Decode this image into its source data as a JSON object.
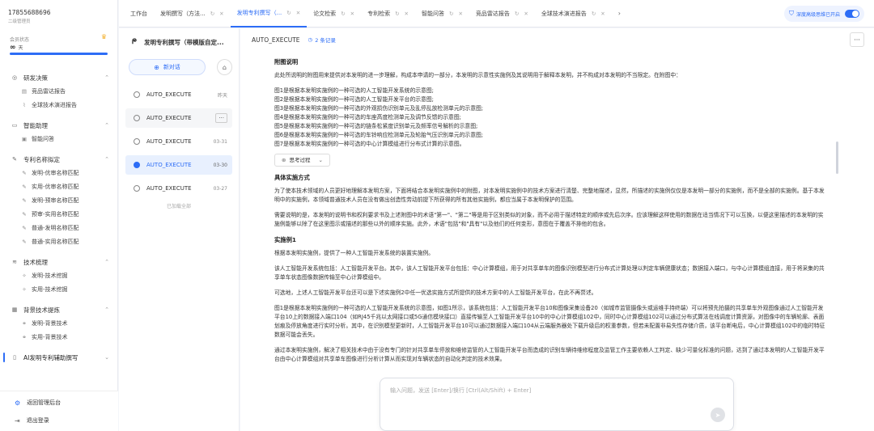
{
  "user": {
    "phone": "17855688696",
    "subtitle": "二级管理员",
    "member_label": "会员状态",
    "member_value_symbol": "∞",
    "member_value_text": "天"
  },
  "nav": {
    "groups": [
      {
        "label": "研发决策",
        "items": [
          "竞品雷达报告",
          "全球技术演进报告"
        ]
      },
      {
        "label": "智能助理",
        "items": [
          "智能问答"
        ]
      },
      {
        "label": "专利名称拟定",
        "items": [
          "发明-优审名称匹配",
          "实用-优审名称匹配",
          "发明-预审名称匹配",
          "预审-实用名称匹配",
          "普通-发明名称匹配",
          "普通-实用名称匹配"
        ]
      },
      {
        "label": "技术梳理",
        "items": [
          "发明-技术挖掘",
          "实用-技术挖掘"
        ]
      },
      {
        "label": "背景技术提炼",
        "items": [
          "发明-背景技术",
          "实用-背景技术"
        ]
      },
      {
        "label": "AI发明专利辅助撰写",
        "items": []
      }
    ],
    "admin_label": "返回管理后台",
    "logout_label": "退出登录"
  },
  "tabs": {
    "items": [
      {
        "label": "工作台"
      },
      {
        "label": "发明撰写（方法..."
      },
      {
        "label": "发明专利撰写（..."
      },
      {
        "label": "论文检索"
      },
      {
        "label": "专利检索"
      },
      {
        "label": "智能问答"
      },
      {
        "label": "竞品雷达报告"
      },
      {
        "label": "全球技术演进报告"
      }
    ],
    "active_index": 2,
    "deep_thinking_label": "深度高级思维已开启"
  },
  "conversations": {
    "title": "发明专利撰写（带模版自定...",
    "new_chat": "新对话",
    "items": [
      {
        "name": "AUTO_EXECUTE",
        "date": "昨天"
      },
      {
        "name": "AUTO_EXECUTE",
        "date": "···"
      },
      {
        "name": "AUTO_EXECUTE",
        "date": "03-31"
      },
      {
        "name": "AUTO_EXECUTE",
        "date": "03-30"
      },
      {
        "name": "AUTO_EXECUTE",
        "date": "03-27"
      }
    ],
    "loaded_all": "已加载全部"
  },
  "main": {
    "title": "AUTO_EXECUTE",
    "record_count": "2 条记录",
    "sec_fig_title": "附图说明",
    "sec_fig_intro": "此处所说明的附图用来提供对本发明的进一步理解，构成本申请的一部分，本发明的示意性实施例及其说明用于解释本发明，并不构成对本发明的不当限定。在附图中：",
    "figs": [
      "图1是根据本发明实施例的一种可选的人工智能开发系统的示意图;",
      "图2是根据本发明实施例的一种可选的人工智能开发平台的示意图;",
      "图3是根据本发明实施例的一种可选的外观损伤识别单元及乱停乱放检测单元的示意图;",
      "图4是根据本发明实施例的一种可选的车座高度检测单元及调节反馈的示意图;",
      "图5是根据本发明实施例的一种可选的链条松紧度识别单元及频率信号解析的示意图;",
      "图6是根据本发明实施例的一种可选的车铃响应检测单元及轮胎气压识别单元的示意图;",
      "图7是根据本发明实施例的一种可选的中心计算模组进行分布式计算的示意图。"
    ],
    "think_label": "思考过程",
    "sec_impl_title": "具体实施方式",
    "impl_p1": "为了使本技术领域的人员更好地理解本发明方案，下面将结合本发明实施例中的附图，对本发明实施例中的技术方案进行清楚、完整地描述，显然，所描述的实施例仅仅是本发明一部分的实施例，而不是全部的实施例。基于本发明中的实施例，本领域普通技术人员在没有做出创造性劳动前提下所获得的所有其他实施例，都应当属于本发明保护的范围。",
    "impl_p2": "需要说明的是，本发明的说明书和权利要求书及上述附图中的术语\"第一\"、\"第二\"等是用于区别类似的对象，而不必用于描述特定的顺序或先后次序。应该理解这样使用的数据在适当情况下可以互换，以便这里描述的本发明的实施例能够以除了在这里图示或描述的那些以外的顺序实施。此外，术语\"包括\"和\"具有\"以及他们的任何变形，意图在于覆盖不排他的包含。",
    "ex1_title": "实施例1",
    "ex1_p1": "根据本发明实施例，提供了一种人工智能开发系统的装置实施例。",
    "ex1_p2": "该人工智能开发系统包括：人工智能开发平台。其中，该人工智能开发平台包括：中心计算模组，用于对共享单车的图像识别模型进行分布式计算处理以判定车辆健康状态；数据接入端口，与中心计算模组连接，用于将采集的共享单车状态图像数据传输至中心计算模组中。",
    "ex1_p3": "可选地，上述人工智能开发平台还可以是下述实施例2中任一优选实施方式所提供的技术方案中的人工智能开发平台，在此不再赘述。",
    "ex1_p4": "图1是根据本发明实施例的一种可选的人工智能开发系统的示意图，如图1所示，该系统包括：人工智能开发平台10和图像采集设备20（如城市监管摄像头或运维手持终端）可以将预先拍摄的共享单车外观图像通过人工智能开发平台10上的数据接入端口104（如RJ45千兆以太网接口或5G通信模块接口）直接传输至人工智能开发平台10中的中心计算模组102中，同时中心计算模组102可以通过分布式算法在线调度计算资源，对图像中的车辆轮廓、表面划痕及停放角度进行实时分析。其中，在识别模型更新时，人工智能开发平台10可以通过数据接入端口104从云端服务器处下载升级后的权重参数，但若未配置非易失性存储介质，该平台断电后，中心计算模组102中的临时特征数据可能会丢失。",
    "ex1_p5": "通过本发明实施例，解决了相关技术中由于没有专门的针对共享单车停放和维修监管的人工智能开发平台而造成的识别车辆待维修程度及监管工作主要依赖人工判定、缺少可量化标准的问题，达到了通过本发明的人工智能开发平台由中心计算模组对共享单车图像进行分析计算从而实现对车辆状态的自动化判定的技术效果。",
    "input_placeholder": "输入问题，发送 [Enter]/换行 [Ctrl(Alt/Shift) + Enter]"
  },
  "colors": {
    "accent": "#2d6df6",
    "crown": "#f3b130"
  }
}
